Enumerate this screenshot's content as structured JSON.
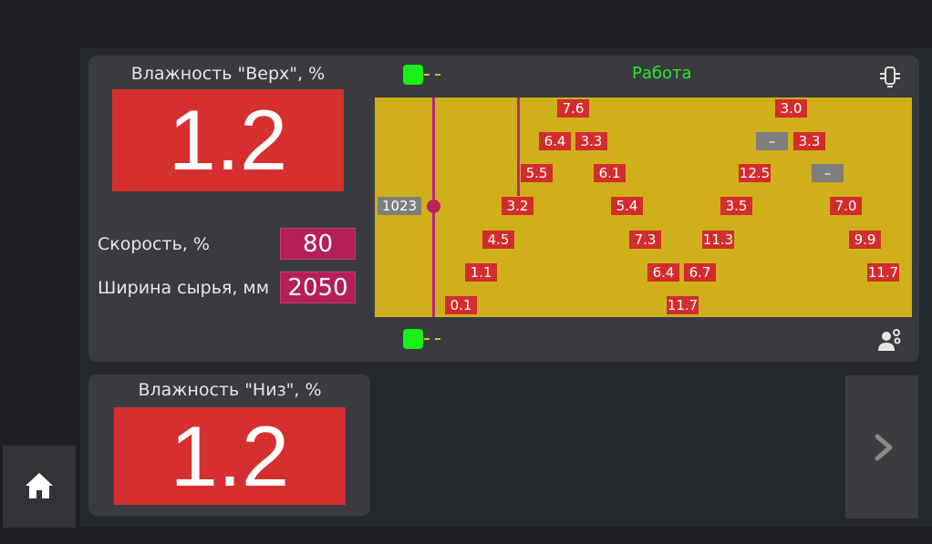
{
  "top": {
    "title": "Влажность \"Верх\", %",
    "value": "1.2",
    "speed_label": "Скорость, %",
    "speed_value": "80",
    "width_label": "Ширина сырья, мм",
    "width_value": "2050",
    "status": "Работа"
  },
  "scan": {
    "position_value": "1023",
    "cells": [
      "7.6",
      "3.0",
      "6.4",
      "3.3",
      "–",
      "3.3",
      "5.5",
      "6.1",
      "12.5",
      "–",
      "3.2",
      "5.4",
      "3.5",
      "7.0",
      "4.5",
      "7.3",
      "11.3",
      "9.9",
      "1.1",
      "6.4",
      "6.7",
      "11.7",
      "0.1",
      "11.7"
    ]
  },
  "bottom": {
    "title": "Влажность \"Низ\", %",
    "value": "1.2"
  },
  "colors": {
    "alarm_red": "#d62f2f",
    "param_magenta": "#b41f57",
    "scan_yellow": "#cfb01a",
    "status_green": "#2ee62e",
    "sensor_green": "#19f019"
  },
  "icons": {
    "top_sensor": "sensor-icon",
    "bottom_sensor": "sensor-icon",
    "device": "device-icon",
    "operator": "operator-settings-icon",
    "home": "home-icon",
    "next": "chevron-right-icon"
  }
}
